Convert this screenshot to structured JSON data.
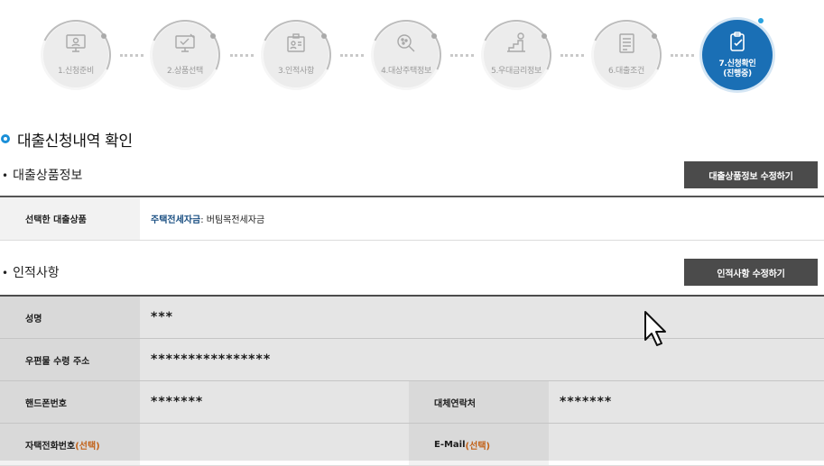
{
  "steps": [
    {
      "label": "1.신청준비",
      "icon": "monitor-icon"
    },
    {
      "label": "2.상품선택",
      "icon": "product-select-icon"
    },
    {
      "label": "3.인적사항",
      "icon": "id-card-icon"
    },
    {
      "label": "4.대상주택정보",
      "icon": "house-search-icon"
    },
    {
      "label": "5.우대금리정보",
      "icon": "rate-stairs-icon"
    },
    {
      "label": "6.대출조건",
      "icon": "document-icon"
    },
    {
      "label": "7.신청확인",
      "sublabel": "(진행중)",
      "icon": "check-document-icon",
      "active": true
    }
  ],
  "page_title": "대출신청내역 확인",
  "loan_section": {
    "bullet": "•",
    "title": "대출상품정보",
    "edit_button": "대출상품정보 수정하기",
    "rows": [
      {
        "label": "선택한 대출상품",
        "value_highlight": "주택전세자금",
        "value_rest": " : 버팀목전세자금"
      }
    ]
  },
  "personal_section": {
    "bullet": "•",
    "title": "인적사항",
    "edit_button": "인적사항 수정하기",
    "name_label": "성명",
    "name_value": "***",
    "address_label": "우편물 수령 주소",
    "address_value": "****************",
    "mobile_label": "핸드폰번호",
    "mobile_value": "*******",
    "alt_contact_label": "대체연락처",
    "alt_contact_value": "*******",
    "home_phone_label": "자택전화번호",
    "home_phone_optional": "(선택)",
    "email_label": "E-Mail",
    "email_optional": "(선택)"
  },
  "colors": {
    "accent": "#1a6fb5",
    "button": "#4b4b4b",
    "optional": "#d86e1c",
    "highlight": "#1a4f82"
  }
}
